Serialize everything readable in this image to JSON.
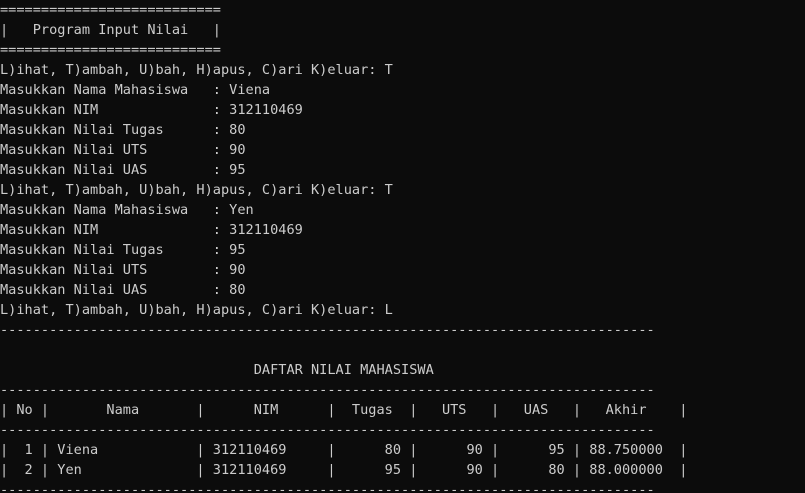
{
  "terminal": {
    "lines": [
      "===========================",
      "|   Program Input Nilai   |",
      "===========================",
      "L)ihat, T)ambah, U)bah, H)apus, C)ari K)eluar: T",
      "Masukkan Nama Mahasiswa   : Viena",
      "Masukkan NIM              : 312110469",
      "Masukkan Nilai Tugas      : 80",
      "Masukkan Nilai UTS        : 90",
      "Masukkan Nilai UAS        : 95",
      "L)ihat, T)ambah, U)bah, H)apus, C)ari K)eluar: T",
      "Masukkan Nama Mahasiswa   : Yen",
      "Masukkan NIM              : 312110469",
      "Masukkan Nilai Tugas      : 95",
      "Masukkan Nilai UTS        : 90",
      "Masukkan Nilai UAS        : 80",
      "L)ihat, T)ambah, U)bah, H)apus, C)ari K)eluar: L",
      "--------------------------------------------------------------------------------",
      "",
      "                               DAFTAR NILAI MAHASISWA",
      "--------------------------------------------------------------------------------",
      "| No |       Nama       |      NIM      |  Tugas  |   UTS   |   UAS   |   Akhir    |",
      "--------------------------------------------------------------------------------",
      "|  1 | Viena            | 312110469     |      80 |      90 |      95 | 88.750000  |",
      "|  2 | Yen              | 312110469     |      95 |      90 |      80 | 88.000000  |",
      "--------------------------------------------------------------------------------"
    ]
  },
  "colors": {
    "background": "#0c0c0c",
    "foreground": "#cccccc"
  }
}
